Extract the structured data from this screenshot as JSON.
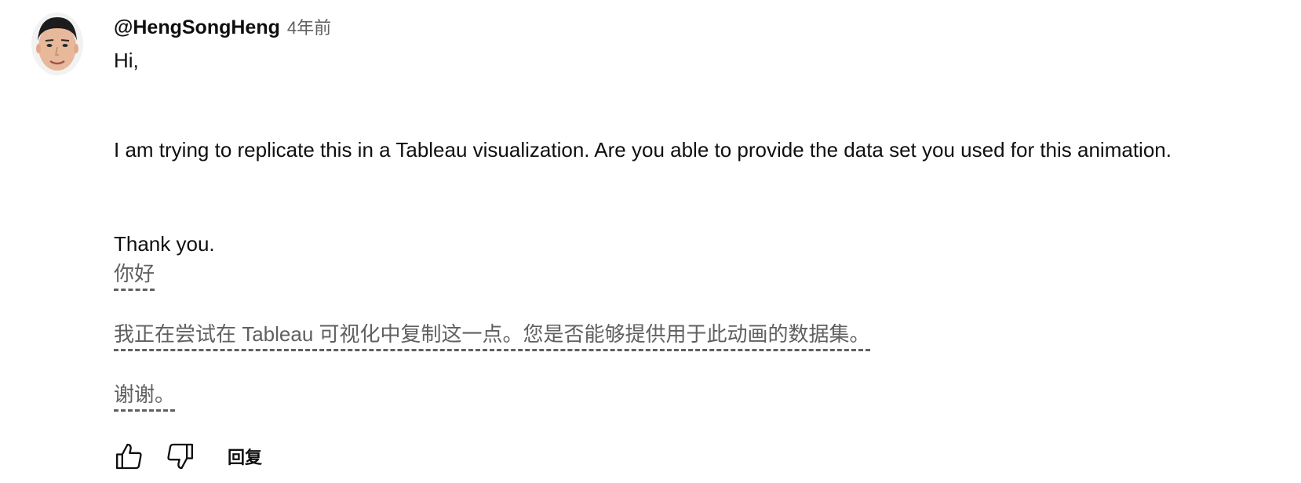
{
  "comment": {
    "author": "@HengSongHeng",
    "timestamp": "4年前",
    "original_text": {
      "greeting": "Hi,",
      "request": "I am trying to replicate this in a Tableau visualization. Are you able to provide  the data set you used for this animation.",
      "thanks": "Thank you."
    },
    "translated_text": {
      "greeting": "你好",
      "request": "我正在尝试在 Tableau 可视化中复制这一点。您是否能够提供用于此动画的数据集。",
      "thanks": "谢谢。"
    },
    "actions": {
      "like_icon": "thumbs-up-outline",
      "dislike_icon": "thumbs-down-outline",
      "reply_label": "回复"
    }
  }
}
